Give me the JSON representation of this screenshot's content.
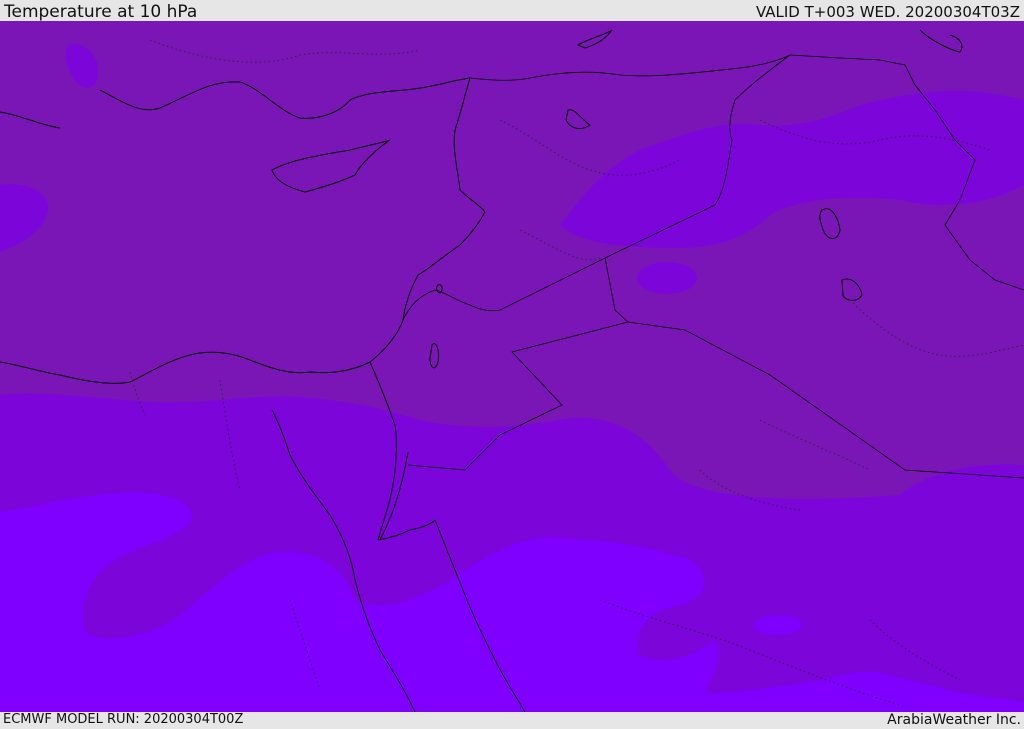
{
  "header": {
    "title": "Temperature at 10 hPa",
    "valid": "VALID T+003 WED. 20200304T03Z"
  },
  "footer": {
    "model_run": "ECMWF MODEL RUN: 20200304T00Z",
    "credit": "ArabiaWeather Inc."
  },
  "colors": {
    "band_warm": "#7a16b6",
    "band_mid": "#7c05da",
    "band_cold": "#7f00fe",
    "coast": "#000000",
    "bar_bg": "#e6e6e6"
  }
}
